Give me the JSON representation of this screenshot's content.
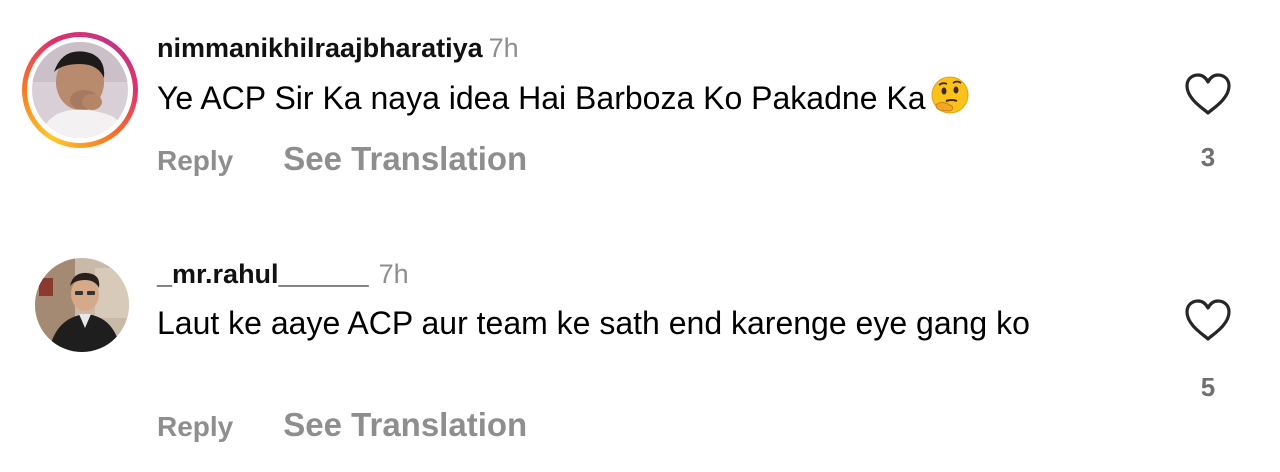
{
  "comments": [
    {
      "username": "nimmanikhilraajbharatiya",
      "time": "7h",
      "text": "Ye ACP Sir Ka naya idea Hai Barboza Ko Pakadne Ka",
      "emoji": "thinking-face-icon",
      "reply_label": "Reply",
      "translate_label": "See Translation",
      "likes": "3",
      "has_story_ring": true
    },
    {
      "username": "_mr.rahul______",
      "time": "7h",
      "text": "Laut ke aaye ACP aur team ke sath end karenge eye gang ko",
      "reply_label": "Reply",
      "translate_label": "See Translation",
      "likes": "5",
      "has_story_ring": false
    }
  ],
  "colors": {
    "meta_gray": "#8e8e8e",
    "text": "#000000",
    "ring_gradient": [
      "#fdc830",
      "#f97b22",
      "#e1306c",
      "#c13584"
    ]
  }
}
